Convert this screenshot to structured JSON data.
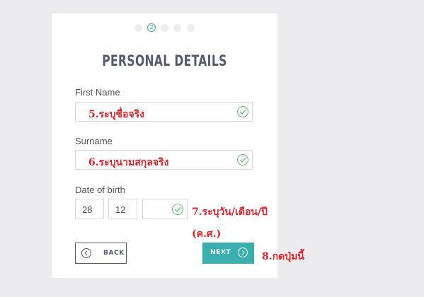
{
  "progress": {
    "active_step": "2"
  },
  "form": {
    "title": "PERSONAL DETAILS",
    "first_name": {
      "label": "First Name",
      "annotation": "5.ระบุชื่อจริง"
    },
    "surname": {
      "label": "Surname",
      "annotation": "6.ระบุนามสกุลจริง"
    },
    "dob": {
      "label": "Date of birth",
      "day": "28",
      "month": "12",
      "year": "",
      "annotation_line1": "7.ระบุวัน/เดือน/ปี",
      "annotation_line2": "(ค.ศ.)"
    },
    "back_label": "BACK",
    "next_label": "NEXT",
    "next_annotation": "8.กดปุ่มนี้"
  },
  "colors": {
    "accent": "#3aafb0",
    "check": "#5cc36b",
    "annotation": "#e3252b",
    "title": "#555a6e"
  }
}
